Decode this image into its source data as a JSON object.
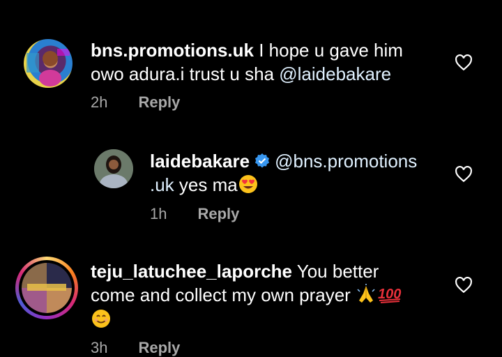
{
  "comments": [
    {
      "username": "bns.promotions.uk",
      "text_line1": " I hope u gave him",
      "text_line2_a": "owo adura.i trust u sha ",
      "mention": "@laidebakare",
      "time": "2h",
      "reply_label": "Reply"
    },
    {
      "username": "laidebakare",
      "mention_a": "@bns.promotions",
      "mention_b": ".uk",
      "text": " yes ma",
      "emoji": "heart-eyes-emoji",
      "time": "1h",
      "reply_label": "Reply"
    },
    {
      "username": "teju_latuchee_laporche",
      "text_line1": " You better",
      "text_line2": "come and collect my own prayer ",
      "emojis": [
        "folded-hands-emoji",
        "hundred-points-emoji",
        "smiling-face-emoji"
      ],
      "time": "3h",
      "reply_label": "Reply"
    }
  ],
  "colors": {
    "background": "#000000",
    "text": "#ffffff",
    "meta": "#a8a8a8",
    "verified": "#3897f0"
  }
}
